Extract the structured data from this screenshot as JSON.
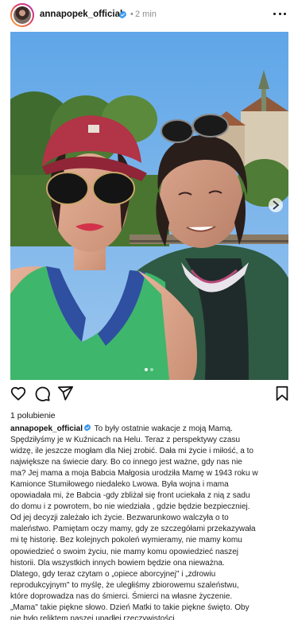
{
  "post": {
    "username": "annapopek_official",
    "separator": "•",
    "time": "2 min",
    "more_icon": "more-horizontal-icon",
    "verified_icon": "verified-badge-icon"
  },
  "media": {
    "carousel_count": 2,
    "carousel_active": 1
  },
  "actions": {
    "icons": [
      "heart-icon",
      "comment-icon",
      "share-icon",
      "bookmark-icon"
    ]
  },
  "likes": "1 polubienie",
  "caption": {
    "username": "annapopek_official",
    "first_line": "To były ostatnie wakacje z moją Mamą.",
    "lines": [
      "Spędziłyśmy je w Kuźnicach na Helu. Teraz z perspektywy czasu",
      "widzę, ile jeszcze mogłam dla Niej zrobić. Dała mi życie i miłość, a to",
      "największe na świecie dary. Bo co innego jest ważne, gdy nas nie",
      "ma? Jej mama a moja Babcia Małgosia urodziła Mamę w 1943 roku w",
      "Kamionce Stumiłowego niedaleko Lwowa. Była wojna i mama",
      "opowiadała mi, że Babcia -gdy zbliżał się front uciekała z nią z sadu",
      "do domu i z powrotem, bo nie wiedziała , gdzie będzie bezpieczniej.",
      "Od jej decyzji zależało ich życie. Bezwarunkowo walczyła o to",
      "maleństwo. Pamiętam oczy mamy, gdy ze szczegółami przekazywała",
      "mi tę historię. Bez kolejnych pokoleń wymieramy, nie mamy komu",
      "opowiedzieć o swoim życiu, nie mamy komu opowiedzieć naszej",
      "historii. Dla wszystkich innych bowiem będzie ona nieważna.",
      "Dlatego, gdy teraz czytam o „opiece aborcyjnej\" i „zdrowiu",
      "reprodukcyjnym\" to myślę, że uległiśmy zbiorowemu szaleństwu,",
      "które doprowadza nas do śmierci. Śmierci na własne życzenie.",
      "„Mama\" takie piękne słowo. Dzień Matki to takie piękne święto. Oby",
      "nie było reliktem naszej upadłej rzeczywistości."
    ]
  },
  "colors": {
    "text": "#111111",
    "secondary": "#8e8e8e",
    "verified": "#3897f0",
    "story_ring_start": "#f9b234",
    "story_ring_end": "#b32ab3"
  }
}
